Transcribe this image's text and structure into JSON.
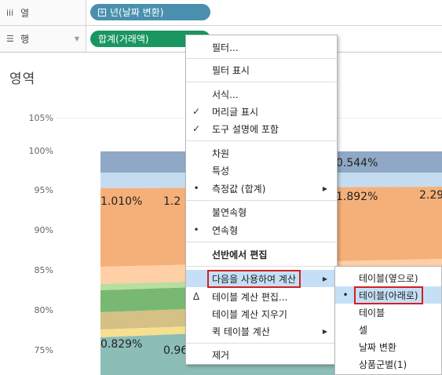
{
  "shelves": {
    "columns": {
      "label": "열",
      "pill": "년(날짜 변환)"
    },
    "rows": {
      "label": "행",
      "pill": "합계(거래액)"
    }
  },
  "view": {
    "title": "영역"
  },
  "chart_data": {
    "type": "area",
    "y_ticks": [
      "105%",
      "100%",
      "95%",
      "90%",
      "85%",
      "80%",
      "75%"
    ],
    "ylim": [
      73,
      105
    ],
    "data_labels": [
      "0.544%",
      "1.010%",
      "1.2",
      "1.892%",
      "2.29",
      "0.829%",
      "0.96"
    ],
    "bands": [
      {
        "color": "#8fa8c5"
      },
      {
        "color": "#c5dcf0"
      },
      {
        "color": "#f5b07a"
      },
      {
        "color": "#ffcfa5"
      },
      {
        "color": "#b8dea0"
      },
      {
        "color": "#78b873"
      },
      {
        "color": "#d5c085"
      },
      {
        "color": "#f6e090"
      },
      {
        "color": "#8cbdb6"
      }
    ]
  },
  "menu": {
    "items": [
      {
        "label": "필터...",
        "mark": "",
        "submenu": false
      },
      {
        "label": "필터 표시",
        "mark": "",
        "submenu": false
      },
      {
        "label": "서식...",
        "mark": "",
        "submenu": false
      },
      {
        "label": "머리글 표시",
        "mark": "✓",
        "submenu": false
      },
      {
        "label": "도구 설명에 포함",
        "mark": "✓",
        "submenu": false
      },
      {
        "label": "차원",
        "mark": "",
        "submenu": false
      },
      {
        "label": "특성",
        "mark": "",
        "submenu": false
      },
      {
        "label": "측정값 (합계)",
        "mark": "•",
        "submenu": true
      },
      {
        "label": "불연속형",
        "mark": "",
        "submenu": false
      },
      {
        "label": "연속형",
        "mark": "•",
        "submenu": false
      },
      {
        "label": "선반에서 편집",
        "mark": "",
        "submenu": false
      },
      {
        "label": "다음을 사용하여 계산",
        "mark": "",
        "submenu": true
      },
      {
        "label": "테이블 계산 편집...",
        "mark": "Δ",
        "submenu": false
      },
      {
        "label": "테이블 계산 지우기",
        "mark": "",
        "submenu": false
      },
      {
        "label": "퀵 테이블 계산",
        "mark": "",
        "submenu": true
      },
      {
        "label": "제거",
        "mark": "",
        "submenu": false
      }
    ]
  },
  "submenu": {
    "items": [
      {
        "label": "테이블(옆으로)",
        "mark": ""
      },
      {
        "label": "테이블(아래로)",
        "mark": "•"
      },
      {
        "label": "테이블",
        "mark": ""
      },
      {
        "label": "셀",
        "mark": ""
      },
      {
        "label": "날짜 변환",
        "mark": ""
      },
      {
        "label": "상품군별(1)",
        "mark": ""
      }
    ]
  }
}
